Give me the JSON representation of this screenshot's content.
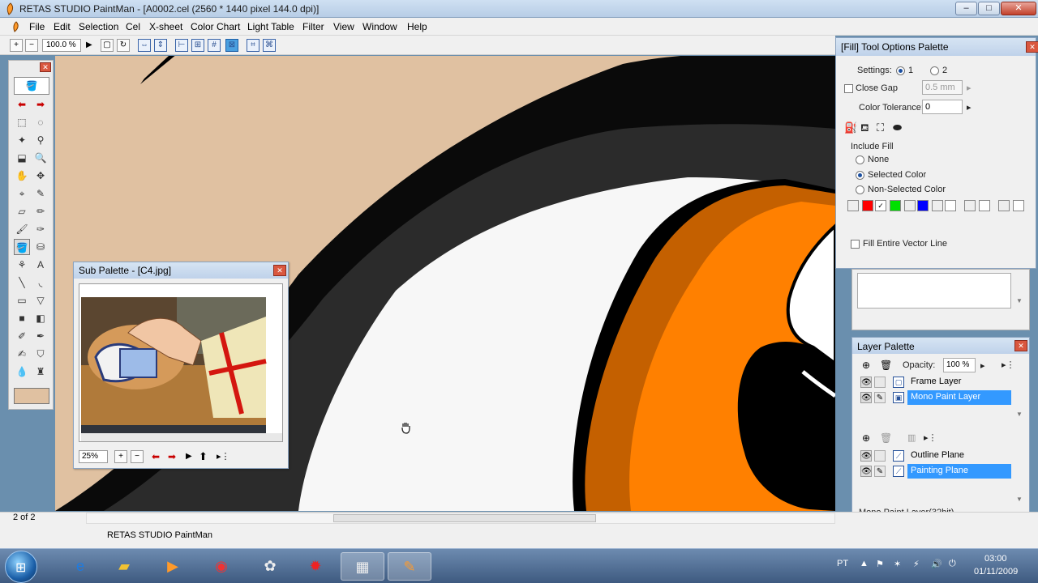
{
  "window": {
    "title": "RETAS STUDIO PaintMan - [A0002.cel (2560 * 1440 pixel 144.0 dpi)]",
    "minimize": "–",
    "maximize": "□",
    "close": "✕"
  },
  "menu": [
    "File",
    "Edit",
    "Selection",
    "Cel",
    "X-sheet",
    "Color Chart",
    "Light Table",
    "Filter",
    "View",
    "Window",
    "Help"
  ],
  "toolbar": {
    "zoom": "100.0 %",
    "play": "▶"
  },
  "sub_palette": {
    "title": "Sub Palette - [C4.jpg]",
    "zoom": "25%"
  },
  "tool_options": {
    "title": "[Fill] Tool Options Palette",
    "settings_label": "Settings:",
    "settings_1": "1",
    "settings_2": "2",
    "close_gap_label": "Close Gap",
    "close_gap_value": "0.5 mm",
    "color_tolerance_label": "Color Tolerance:",
    "color_tolerance_value": "0",
    "include_fill_label": "Include Fill",
    "option_none": "None",
    "option_selected": "Selected Color",
    "option_non_selected": "Non-Selected Color",
    "fill_vector_label": "Fill Entire Vector Line"
  },
  "layer_palette": {
    "title": "Layer Palette",
    "opacity_label": "Opacity:",
    "opacity_value": "100 %",
    "layers": [
      "Frame Layer",
      "Mono Paint Layer"
    ],
    "planes": [
      "Outline Plane",
      "Painting Plane"
    ],
    "status": "Mono Paint Layer(32bit)"
  },
  "status": {
    "page": "2 of 2",
    "message": "RETAS STUDIO PaintMan"
  },
  "taskbar": {
    "lang": "PT",
    "time": "03:00",
    "date": "01/11/2009"
  },
  "colors": {
    "skin": "#e0c1a1",
    "orange": "#ff8000",
    "dark_orange": "#c46000",
    "outline": "#000000",
    "selection_blue": "#3399ff"
  }
}
